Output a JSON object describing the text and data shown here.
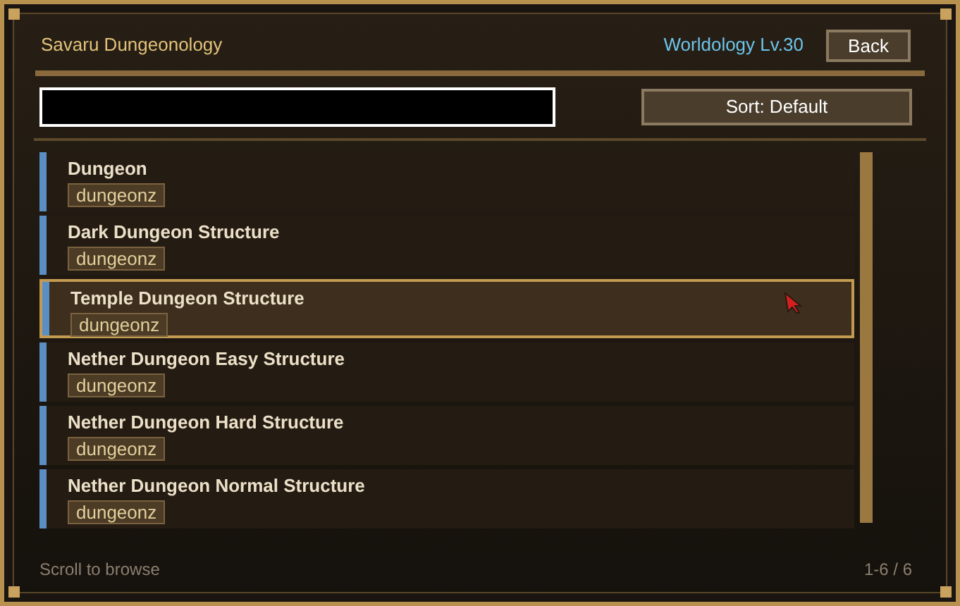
{
  "header": {
    "title": "Savaru Dungeonology",
    "level": "Worldology Lv.30",
    "back_button": "Back"
  },
  "sort_button": "Sort: Default",
  "rows": [
    {
      "name": "Dungeon",
      "tag": "dungeonz",
      "selected": false
    },
    {
      "name": "Dark Dungeon Structure",
      "tag": "dungeonz",
      "selected": false
    },
    {
      "name": "Temple Dungeon Structure",
      "tag": "dungeonz",
      "selected": true
    },
    {
      "name": "Nether Dungeon Easy Structure",
      "tag": "dungeonz",
      "selected": false
    },
    {
      "name": "Nether Dungeon Hard Structure",
      "tag": "dungeonz",
      "selected": false
    },
    {
      "name": "Nether Dungeon Normal Structure",
      "tag": "dungeonz",
      "selected": false
    }
  ],
  "footer": {
    "hint": "Scroll to browse",
    "count": "1-6 / 6"
  }
}
